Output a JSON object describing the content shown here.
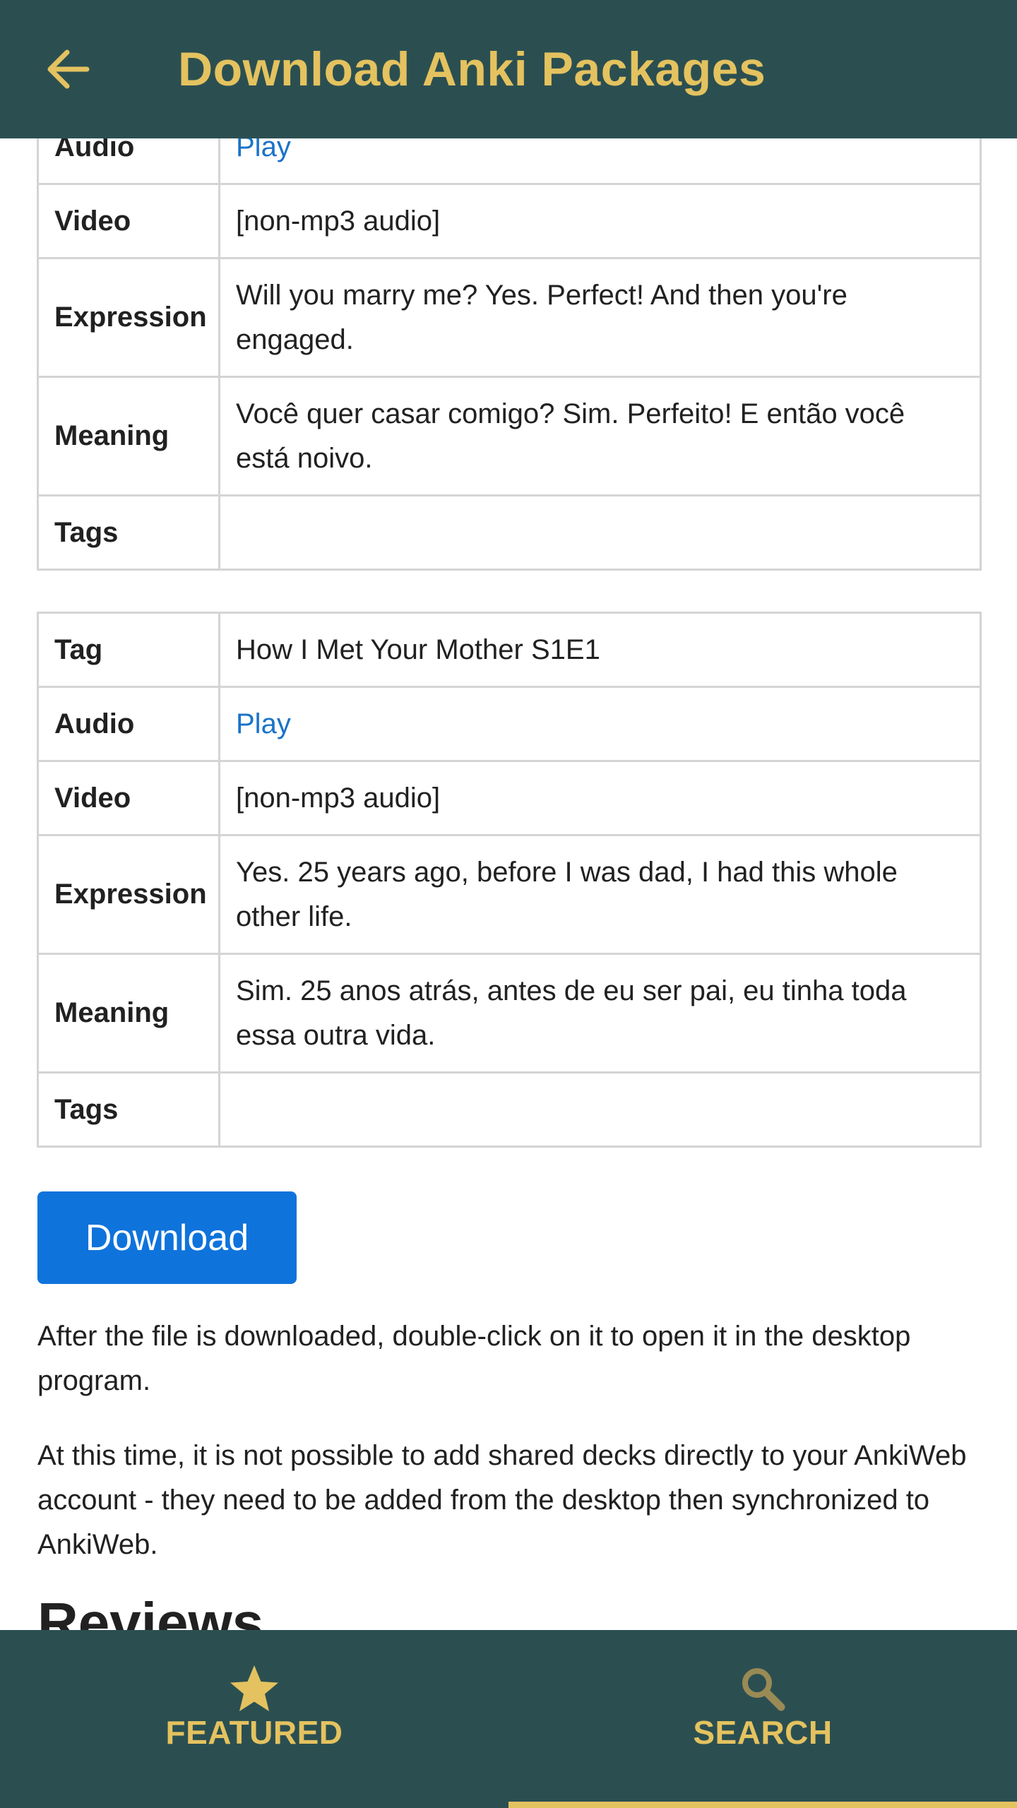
{
  "appbar": {
    "title": "Download Anki Packages",
    "back_icon": "arrow-left-icon",
    "colors": {
      "bar": "#2b4f51",
      "accent": "#e4c25f"
    }
  },
  "note1": {
    "rows": [
      {
        "key": "Audio",
        "value": "Play"
      },
      {
        "key": "Video",
        "value": "[non-mp3 audio]"
      },
      {
        "key": "Expression",
        "value": "Will you marry me? Yes. Perfect! And then you're engaged."
      },
      {
        "key": "Meaning",
        "value": "Você quer casar comigo? Sim. Perfeito! E então você está noivo."
      },
      {
        "key": "Tags",
        "value": ""
      }
    ]
  },
  "note2": {
    "rows": [
      {
        "key": "Tag",
        "value": "How I Met Your Mother S1E1"
      },
      {
        "key": "Audio",
        "value": "Play"
      },
      {
        "key": "Video",
        "value": "[non-mp3 audio]"
      },
      {
        "key": "Expression",
        "value": "Yes. 25 years ago, before I was dad, I had this whole other life."
      },
      {
        "key": "Meaning",
        "value": "Sim. 25 anos atrás, antes de eu ser pai, eu tinha toda essa outra vida."
      },
      {
        "key": "Tags",
        "value": ""
      }
    ]
  },
  "download": {
    "button_label": "Download",
    "color": "#0f73dc",
    "info": "After the file is downloaded, double-click on it to open it in the desktop program.",
    "note": "At this time, it is not possible to add shared decks directly to your AnkiWeb account - they need to be added from the desktop then synchronized to AnkiWeb."
  },
  "reviews": {
    "heading": "Reviews"
  },
  "bottom_nav": {
    "items": [
      {
        "label": "FEATURED",
        "icon": "star-icon",
        "selected": false
      },
      {
        "label": "SEARCH",
        "icon": "search-icon",
        "selected": true
      }
    ]
  }
}
